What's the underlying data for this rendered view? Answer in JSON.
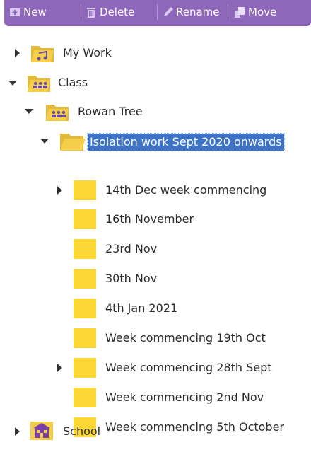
{
  "colors": {
    "toolbar": "#8e66ba",
    "folder": "#fdd835",
    "folder_special": "#ebc248",
    "selection": "#3d72c4",
    "school_icon": "#7b3fa8"
  },
  "toolbar": {
    "new_label": "New",
    "delete_label": "Delete",
    "rename_label": "Rename",
    "move_label": "Move"
  },
  "tree": {
    "my_work": {
      "label": "My Work",
      "icon": "folder-music-icon",
      "expanded": false
    },
    "class": {
      "label": "Class",
      "icon": "folder-class-icon",
      "expanded": true
    },
    "rowan_tree": {
      "label": "Rowan Tree",
      "icon": "folder-class-icon",
      "expanded": true
    },
    "isolation": {
      "label": "Isolation work Sept 2020 onwards",
      "icon": "folder-open-icon",
      "expanded": true,
      "selected": true
    },
    "children": [
      {
        "label": "14th Dec week commencing",
        "has_children": true
      },
      {
        "label": "16th November",
        "has_children": false
      },
      {
        "label": "23rd Nov",
        "has_children": false
      },
      {
        "label": "30th Nov",
        "has_children": false
      },
      {
        "label": "4th Jan 2021",
        "has_children": false
      },
      {
        "label": "Week commencing 19th Oct",
        "has_children": false
      },
      {
        "label": "Week commencing 28th Sept",
        "has_children": true
      },
      {
        "label": "Week commencing 2nd Nov",
        "has_children": false
      },
      {
        "label": "Week commencing 5th October",
        "has_children": false
      }
    ],
    "school": {
      "label": "School",
      "icon": "school-icon",
      "expanded": false
    }
  }
}
